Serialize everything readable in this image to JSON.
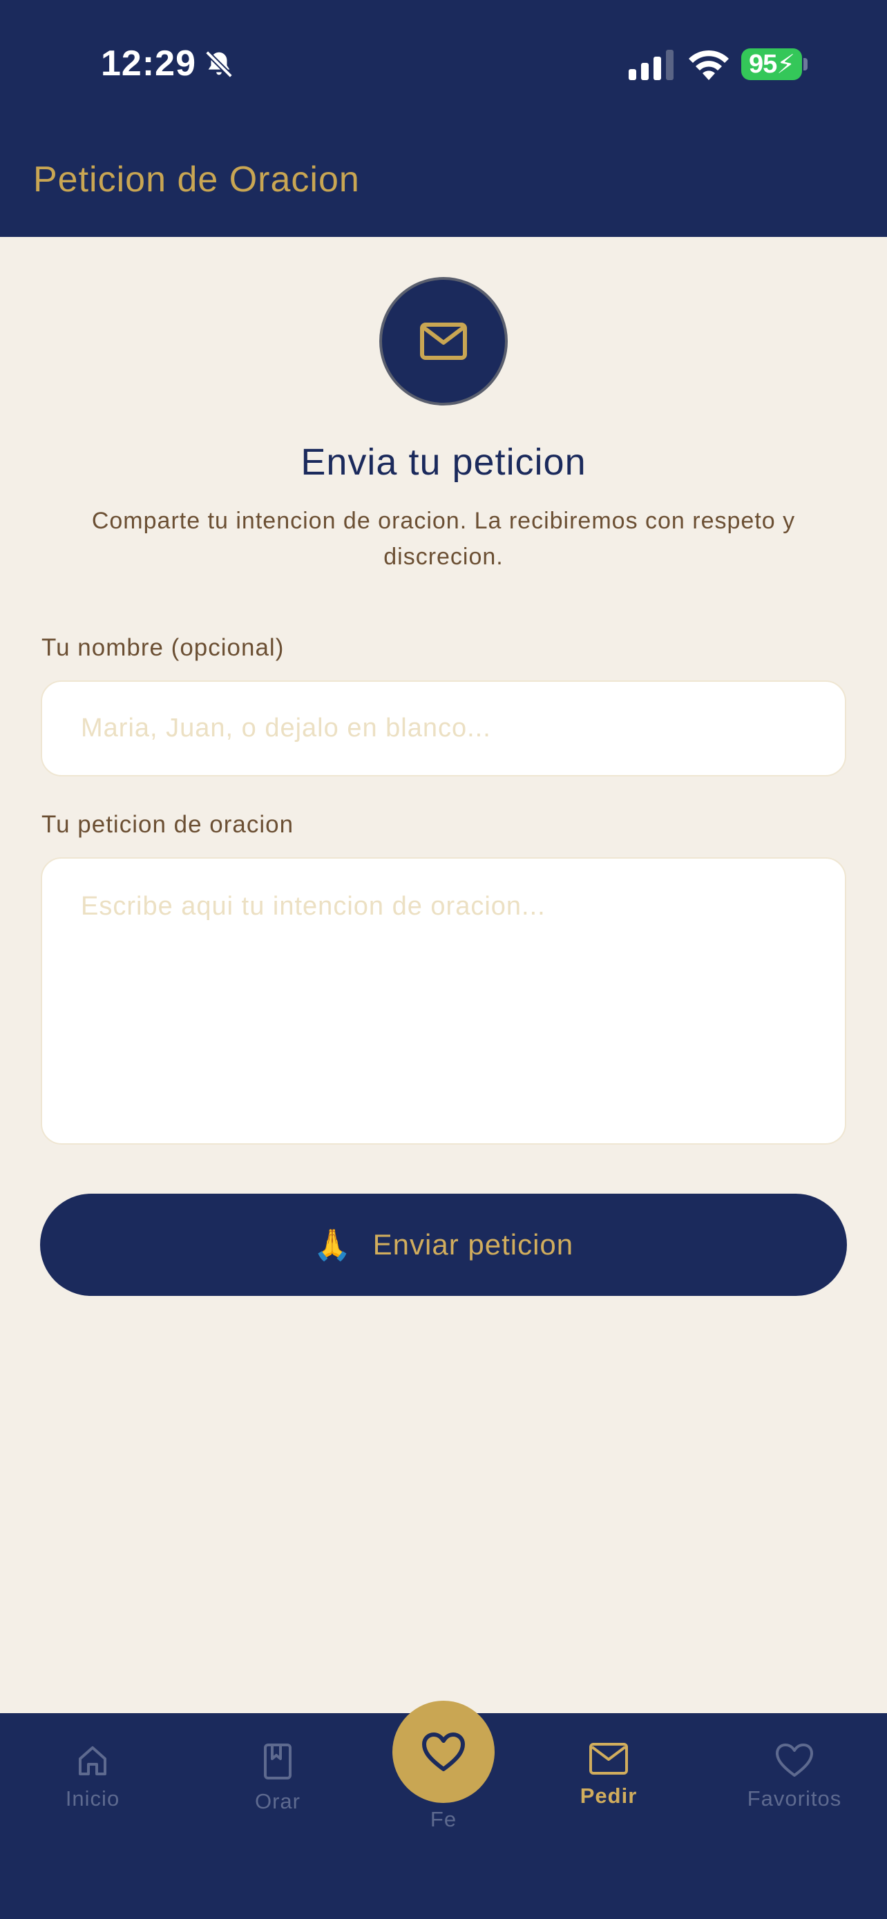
{
  "status_bar": {
    "time": "12:29",
    "battery": "95",
    "icons": [
      "bell-slash-icon",
      "signal-icon",
      "wifi-icon",
      "battery-charging-icon"
    ]
  },
  "header": {
    "title": "Peticion de Oracion"
  },
  "hero": {
    "icon": "envelope-icon",
    "heading": "Envia tu peticion",
    "subtitle": "Comparte tu intencion de oracion. La recibiremos con respeto y discrecion."
  },
  "form": {
    "name_label": "Tu nombre (opcional)",
    "name_placeholder": "Maria, Juan, o dejalo en blanco...",
    "name_value": "",
    "request_label": "Tu peticion de oracion",
    "request_placeholder": "Escribe aqui tu intencion de oracion...",
    "request_value": "",
    "submit_emoji": "🙏",
    "submit_label": "Enviar peticion"
  },
  "nav": {
    "items": [
      {
        "label": "Inicio",
        "icon": "home-icon",
        "active": false
      },
      {
        "label": "Orar",
        "icon": "book-icon",
        "active": false
      },
      {
        "label": "Fe",
        "icon": "heart-icon",
        "active": false
      },
      {
        "label": "Pedir",
        "icon": "envelope-icon",
        "active": true
      },
      {
        "label": "Favoritos",
        "icon": "heart-outline-icon",
        "active": false
      }
    ]
  },
  "colors": {
    "navy": "#1b2a5c",
    "gold": "#c9a653",
    "background": "#f4efe7",
    "text_brown": "#6b4f33",
    "nav_inactive": "#5e6a8f",
    "battery_green": "#34c759"
  }
}
